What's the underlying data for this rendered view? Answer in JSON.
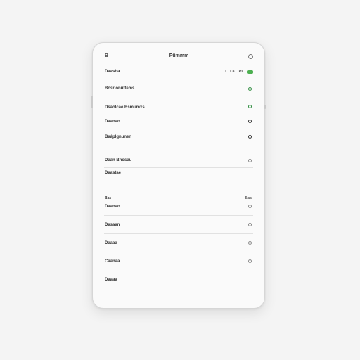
{
  "header": {
    "back_label": "B",
    "title": "Pümmm"
  },
  "toolbar": {
    "label1": "Ca",
    "label2": "Rs"
  },
  "section_title": "Daasba",
  "group1": {
    "items": [
      {
        "label": "Bosrlonuttems"
      },
      {
        "label": "Dsaolcae Bsmumxs"
      },
      {
        "label": "Daanao"
      },
      {
        "label": "Baáplgnunen"
      }
    ]
  },
  "group2": {
    "items": [
      {
        "label": "Daan Bnosau"
      },
      {
        "label": "Daastae"
      }
    ]
  },
  "group3": {
    "heading": "Bas",
    "heading_right": "Bas",
    "items": [
      {
        "label": "Daanao"
      },
      {
        "label": "Dasaan"
      },
      {
        "label": "Daaaa"
      },
      {
        "label": "Caanaa"
      },
      {
        "label": "Daaaa"
      }
    ]
  },
  "colors": {
    "accent_green": "#2e8b3e",
    "toggle_green": "#4caf50"
  }
}
